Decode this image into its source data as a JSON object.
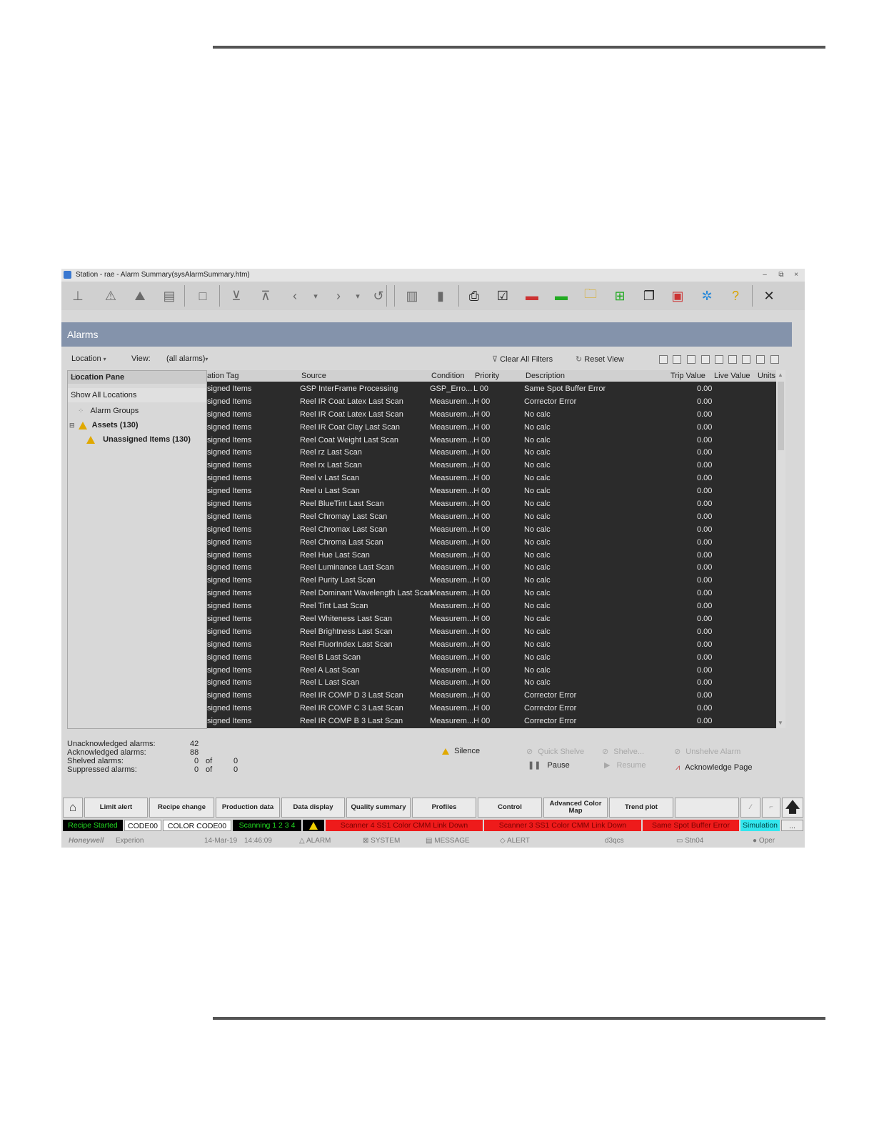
{
  "window": {
    "title": "Station - rae - Alarm Summary(sysAlarmSummary.htm)",
    "min": "–",
    "restore": "⧉",
    "close": "×"
  },
  "toolbar": {
    "buttons": [
      {
        "name": "hierarchy-icon",
        "glyph": "⊥"
      },
      {
        "name": "alarm-icon",
        "glyph": "⚠"
      },
      {
        "name": "alarm-mountain-icon",
        "glyph": "⛰"
      },
      {
        "name": "display-icon",
        "glyph": "▤"
      },
      {
        "name": "square-icon",
        "glyph": "□"
      },
      {
        "name": "checkbox-down-icon",
        "glyph": "⊻"
      },
      {
        "name": "checkbox-up-icon",
        "glyph": "⊼"
      },
      {
        "name": "back-icon",
        "glyph": "‹"
      },
      {
        "name": "back-dropdown-icon",
        "glyph": "▾"
      },
      {
        "name": "forward-icon",
        "glyph": "›"
      },
      {
        "name": "forward-dropdown-icon",
        "glyph": "▾"
      },
      {
        "name": "refresh-icon",
        "glyph": "↺"
      },
      {
        "name": "trend-icon",
        "glyph": "▥"
      },
      {
        "name": "columns-icon",
        "glyph": "▮"
      },
      {
        "name": "print-icon",
        "glyph": "⎙"
      },
      {
        "name": "checklist-icon",
        "glyph": "☑"
      },
      {
        "name": "red-panel-icon",
        "glyph": "▬"
      },
      {
        "name": "green-panel-icon",
        "glyph": "▬"
      },
      {
        "name": "folder-icon",
        "glyph": "🗀"
      },
      {
        "name": "group-display-icon",
        "glyph": "⊞"
      },
      {
        "name": "windows-icon",
        "glyph": "❐"
      },
      {
        "name": "red-display-icon",
        "glyph": "▣"
      },
      {
        "name": "config-icon",
        "glyph": "✲"
      },
      {
        "name": "help-icon",
        "glyph": "?"
      },
      {
        "name": "close-display-icon",
        "glyph": "✕"
      }
    ]
  },
  "header": {
    "title": "Alarms"
  },
  "filters": {
    "location_label": "Location",
    "view_label": "View:",
    "view_value": "(all alarms)",
    "clear_filters": "Clear All Filters",
    "reset_view": "Reset View"
  },
  "location_pane": {
    "title": "Location Pane",
    "show_all": "Show All Locations",
    "alarm_groups": "Alarm Groups",
    "assets": "Assets (130)",
    "unassigned": "Unassigned Items (130)"
  },
  "columns": {
    "tag": "ation Tag",
    "source": "Source",
    "condition": "Condition",
    "priority": "Priority",
    "description": "Description",
    "trip": "Trip Value",
    "live": "Live Value",
    "units": "Units"
  },
  "rows": [
    {
      "tag": "signed Items",
      "source": "GSP InterFrame Processing",
      "condition": "GSP_Erro...",
      "priority": "L 00",
      "description": "Same Spot Buffer Error",
      "trip": "0.00"
    },
    {
      "tag": "signed Items",
      "source": "Reel IR Coat Latex Last Scan",
      "condition": "Measurem...",
      "priority": "H 00",
      "description": "Corrector Error",
      "trip": "0.00"
    },
    {
      "tag": "signed Items",
      "source": "Reel IR Coat Latex Last Scan",
      "condition": "Measurem...",
      "priority": "H 00",
      "description": "No calc",
      "trip": "0.00"
    },
    {
      "tag": "signed Items",
      "source": "Reel IR Coat Clay Last Scan",
      "condition": "Measurem...",
      "priority": "H 00",
      "description": "No calc",
      "trip": "0.00"
    },
    {
      "tag": "signed Items",
      "source": "Reel Coat Weight Last Scan",
      "condition": "Measurem...",
      "priority": "H 00",
      "description": "No calc",
      "trip": "0.00"
    },
    {
      "tag": "signed Items",
      "source": "Reel rz Last Scan",
      "condition": "Measurem...",
      "priority": "H 00",
      "description": "No calc",
      "trip": "0.00"
    },
    {
      "tag": "signed Items",
      "source": "Reel rx Last Scan",
      "condition": "Measurem...",
      "priority": "H 00",
      "description": "No calc",
      "trip": "0.00"
    },
    {
      "tag": "signed Items",
      "source": "Reel v Last Scan",
      "condition": "Measurem...",
      "priority": "H 00",
      "description": "No calc",
      "trip": "0.00"
    },
    {
      "tag": "signed Items",
      "source": "Reel u Last Scan",
      "condition": "Measurem...",
      "priority": "H 00",
      "description": "No calc",
      "trip": "0.00"
    },
    {
      "tag": "signed Items",
      "source": "Reel BlueTint Last Scan",
      "condition": "Measurem...",
      "priority": "H 00",
      "description": "No calc",
      "trip": "0.00"
    },
    {
      "tag": "signed Items",
      "source": "Reel Chromay Last Scan",
      "condition": "Measurem...",
      "priority": "H 00",
      "description": "No calc",
      "trip": "0.00"
    },
    {
      "tag": "signed Items",
      "source": "Reel Chromax Last Scan",
      "condition": "Measurem...",
      "priority": "H 00",
      "description": "No calc",
      "trip": "0.00"
    },
    {
      "tag": "signed Items",
      "source": "Reel Chroma Last Scan",
      "condition": "Measurem...",
      "priority": "H 00",
      "description": "No calc",
      "trip": "0.00"
    },
    {
      "tag": "signed Items",
      "source": "Reel Hue Last Scan",
      "condition": "Measurem...",
      "priority": "H 00",
      "description": "No calc",
      "trip": "0.00"
    },
    {
      "tag": "signed Items",
      "source": "Reel Luminance Last Scan",
      "condition": "Measurem...",
      "priority": "H 00",
      "description": "No calc",
      "trip": "0.00"
    },
    {
      "tag": "signed Items",
      "source": "Reel Purity Last Scan",
      "condition": "Measurem...",
      "priority": "H 00",
      "description": "No calc",
      "trip": "0.00"
    },
    {
      "tag": "signed Items",
      "source": "Reel Dominant Wavelength Last Scan",
      "condition": "Measurem...",
      "priority": "H 00",
      "description": "No calc",
      "trip": "0.00"
    },
    {
      "tag": "signed Items",
      "source": "Reel Tint Last Scan",
      "condition": "Measurem...",
      "priority": "H 00",
      "description": "No calc",
      "trip": "0.00"
    },
    {
      "tag": "signed Items",
      "source": "Reel Whiteness Last Scan",
      "condition": "Measurem...",
      "priority": "H 00",
      "description": "No calc",
      "trip": "0.00"
    },
    {
      "tag": "signed Items",
      "source": "Reel Brightness Last Scan",
      "condition": "Measurem...",
      "priority": "H 00",
      "description": "No calc",
      "trip": "0.00"
    },
    {
      "tag": "signed Items",
      "source": "Reel FluorIndex Last Scan",
      "condition": "Measurem...",
      "priority": "H 00",
      "description": "No calc",
      "trip": "0.00"
    },
    {
      "tag": "signed Items",
      "source": "Reel B Last Scan",
      "condition": "Measurem...",
      "priority": "H 00",
      "description": "No calc",
      "trip": "0.00"
    },
    {
      "tag": "signed Items",
      "source": "Reel A Last Scan",
      "condition": "Measurem...",
      "priority": "H 00",
      "description": "No calc",
      "trip": "0.00"
    },
    {
      "tag": "signed Items",
      "source": "Reel L Last Scan",
      "condition": "Measurem...",
      "priority": "H 00",
      "description": "No calc",
      "trip": "0.00"
    },
    {
      "tag": "signed Items",
      "source": "Reel IR COMP D 3 Last Scan",
      "condition": "Measurem...",
      "priority": "H 00",
      "description": "Corrector Error",
      "trip": "0.00"
    },
    {
      "tag": "signed Items",
      "source": "Reel IR COMP C 3 Last Scan",
      "condition": "Measurem...",
      "priority": "H 00",
      "description": "Corrector Error",
      "trip": "0.00"
    },
    {
      "tag": "signed Items",
      "source": "Reel IR COMP B 3 Last Scan",
      "condition": "Measurem...",
      "priority": "H 00",
      "description": "Corrector Error",
      "trip": "0.00"
    }
  ],
  "stats": {
    "unack_label": "Unacknowledged alarms:",
    "unack_value": "42",
    "ack_label": "Acknowledged alarms:",
    "ack_value": "88",
    "shelved_label": "Shelved alarms:",
    "shelved_value": "0",
    "shelved_of": "of",
    "shelved_total": "0",
    "suppressed_label": "Suppressed alarms:",
    "suppressed_value": "0",
    "suppressed_of": "of",
    "suppressed_total": "0"
  },
  "actions": {
    "silence": "Silence",
    "quick_shelve": "Quick Shelve",
    "pause": "Pause",
    "shelve": "Shelve...",
    "resume": "Resume",
    "unshelve": "Unshelve Alarm",
    "acknowledge": "Acknowledge Page"
  },
  "nav": {
    "limit_alert": "Limit alert",
    "recipe_change": "Recipe change",
    "production_data": "Production data",
    "data_display": "Data display",
    "quality_summary": "Quality summary",
    "profiles": "Profiles",
    "control": "Control",
    "advanced_color_map": "Advanced Color Map",
    "trend_plot": "Trend plot"
  },
  "status": {
    "recipe": "Recipe Started",
    "code": "CODE00",
    "color_code": "COLOR CODE00",
    "scanning": "Scanning 1 2 3 4",
    "msg1": "Scanner 4 SS1 Color CMM Link Down",
    "msg2": "Scanner 3 SS1 Color CMM Link Down",
    "msg3": "Same Spot Buffer Error",
    "simulation": "Simulation",
    "more": "..."
  },
  "footer": {
    "brand": "Honeywell",
    "product": "Experion",
    "date": "14-Mar-19",
    "time": "14:46:09",
    "alarm": "ALARM",
    "system": "SYSTEM",
    "message": "MESSAGE",
    "alert": "ALERT",
    "server": "d3qcs",
    "station": "Stn04",
    "user": "Oper"
  },
  "colors": {
    "header_bg": "#8493ab",
    "grid_bg": "#2b2b2b",
    "status_green": "#22aa22",
    "status_red": "#ee1b1b",
    "status_cyan": "#33e6ee"
  }
}
